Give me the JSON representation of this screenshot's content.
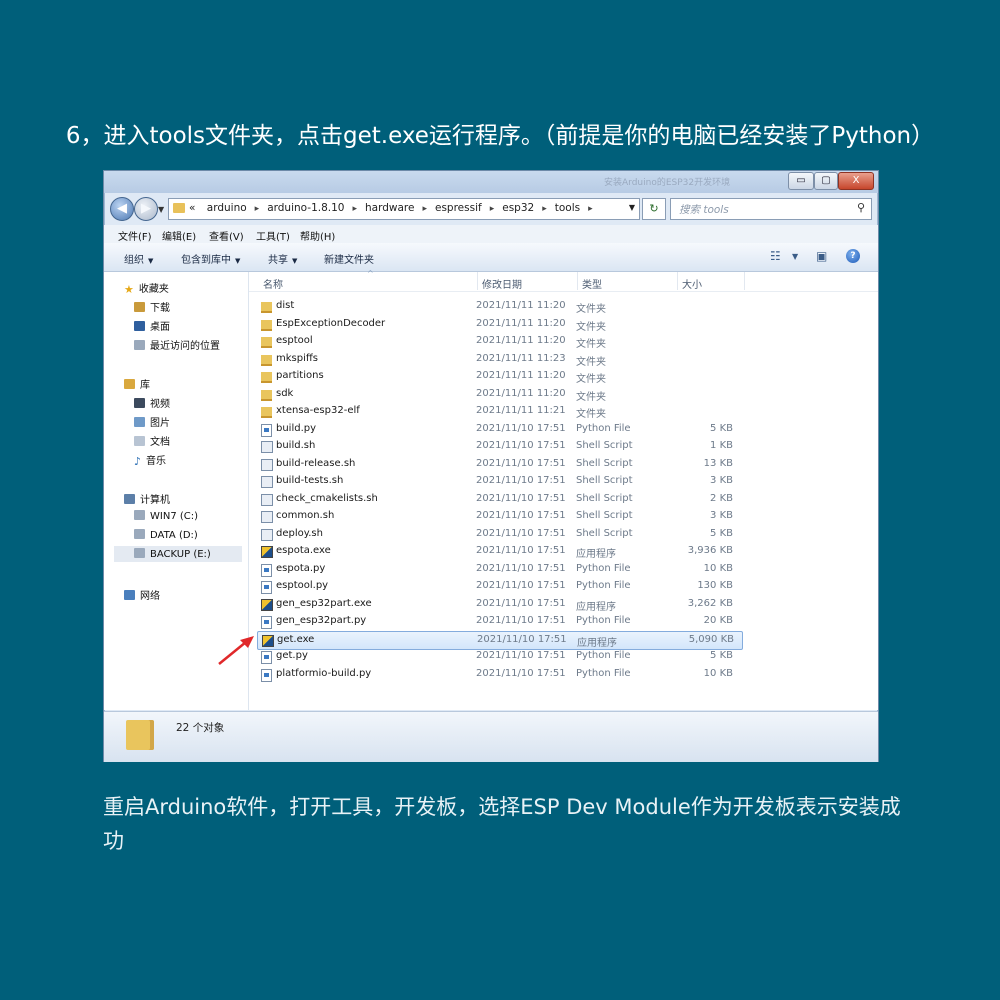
{
  "heading": "6，进入tools文件夹，点击get.exe运行程序。（前提是你的电脑已经安装了Python）",
  "caption": "重启Arduino软件，打开工具，开发板，选择ESP Dev Module作为开发板表示安装成功",
  "window": {
    "ghost_title": "安装Arduino的ESP32开发环境",
    "controls": {
      "minimize": "▭",
      "maximize": "▢",
      "close": "X"
    },
    "address": {
      "prefix": "«",
      "crumbs": [
        "arduino",
        "arduino-1.8.10",
        "hardware",
        "espressif",
        "esp32",
        "tools"
      ],
      "separator": "▸"
    },
    "search_placeholder": "搜索 tools",
    "menu": [
      "文件(F)",
      "编辑(E)",
      "查看(V)",
      "工具(T)",
      "帮助(H)"
    ],
    "toolbar": {
      "organize": "组织",
      "include_library": "包含到库中",
      "share": "共享",
      "new_folder": "新建文件夹"
    },
    "nav": {
      "favorites": {
        "label": "收藏夹",
        "items": [
          "下载",
          "桌面",
          "最近访问的位置"
        ]
      },
      "libraries": {
        "label": "库",
        "items": [
          "视频",
          "图片",
          "文档",
          "音乐"
        ]
      },
      "computer": {
        "label": "计算机",
        "items": [
          "WIN7 (C:)",
          "DATA (D:)",
          "BACKUP (E:)"
        ]
      },
      "network": {
        "label": "网络"
      }
    },
    "columns": {
      "name": "名称",
      "date": "修改日期",
      "type": "类型",
      "size": "大小"
    },
    "files": [
      {
        "name": "dist",
        "date": "2021/11/11 11:20",
        "type": "文件夹",
        "size": "",
        "kind": "folder"
      },
      {
        "name": "EspExceptionDecoder",
        "date": "2021/11/11 11:20",
        "type": "文件夹",
        "size": "",
        "kind": "folder"
      },
      {
        "name": "esptool",
        "date": "2021/11/11 11:20",
        "type": "文件夹",
        "size": "",
        "kind": "folder"
      },
      {
        "name": "mkspiffs",
        "date": "2021/11/11 11:23",
        "type": "文件夹",
        "size": "",
        "kind": "folder"
      },
      {
        "name": "partitions",
        "date": "2021/11/11 11:20",
        "type": "文件夹",
        "size": "",
        "kind": "folder"
      },
      {
        "name": "sdk",
        "date": "2021/11/11 11:20",
        "type": "文件夹",
        "size": "",
        "kind": "folder"
      },
      {
        "name": "xtensa-esp32-elf",
        "date": "2021/11/11 11:21",
        "type": "文件夹",
        "size": "",
        "kind": "folder"
      },
      {
        "name": "build.py",
        "date": "2021/11/10 17:51",
        "type": "Python File",
        "size": "5 KB",
        "kind": "py"
      },
      {
        "name": "build.sh",
        "date": "2021/11/10 17:51",
        "type": "Shell Script",
        "size": "1 KB",
        "kind": "sh"
      },
      {
        "name": "build-release.sh",
        "date": "2021/11/10 17:51",
        "type": "Shell Script",
        "size": "13 KB",
        "kind": "sh"
      },
      {
        "name": "build-tests.sh",
        "date": "2021/11/10 17:51",
        "type": "Shell Script",
        "size": "3 KB",
        "kind": "sh"
      },
      {
        "name": "check_cmakelists.sh",
        "date": "2021/11/10 17:51",
        "type": "Shell Script",
        "size": "2 KB",
        "kind": "sh"
      },
      {
        "name": "common.sh",
        "date": "2021/11/10 17:51",
        "type": "Shell Script",
        "size": "3 KB",
        "kind": "sh"
      },
      {
        "name": "deploy.sh",
        "date": "2021/11/10 17:51",
        "type": "Shell Script",
        "size": "5 KB",
        "kind": "sh"
      },
      {
        "name": "espota.exe",
        "date": "2021/11/10 17:51",
        "type": "应用程序",
        "size": "3,936 KB",
        "kind": "exe"
      },
      {
        "name": "espota.py",
        "date": "2021/11/10 17:51",
        "type": "Python File",
        "size": "10 KB",
        "kind": "py"
      },
      {
        "name": "esptool.py",
        "date": "2021/11/10 17:51",
        "type": "Python File",
        "size": "130 KB",
        "kind": "py"
      },
      {
        "name": "gen_esp32part.exe",
        "date": "2021/11/10 17:51",
        "type": "应用程序",
        "size": "3,262 KB",
        "kind": "exe"
      },
      {
        "name": "gen_esp32part.py",
        "date": "2021/11/10 17:51",
        "type": "Python File",
        "size": "20 KB",
        "kind": "py"
      },
      {
        "name": "get.exe",
        "date": "2021/11/10 17:51",
        "type": "应用程序",
        "size": "5,090 KB",
        "kind": "exe",
        "selected": true
      },
      {
        "name": "get.py",
        "date": "2021/11/10 17:51",
        "type": "Python File",
        "size": "5 KB",
        "kind": "py"
      },
      {
        "name": "platformio-build.py",
        "date": "2021/11/10 17:51",
        "type": "Python File",
        "size": "10 KB",
        "kind": "py"
      }
    ],
    "status": "22 个对象"
  },
  "arrow_color": "#e0282a"
}
